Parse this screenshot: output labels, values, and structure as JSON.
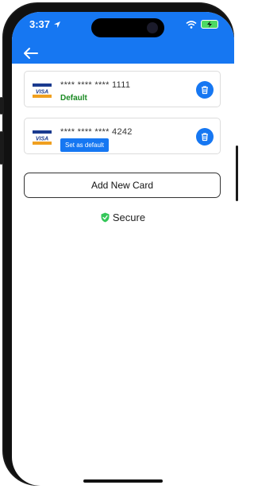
{
  "status_bar": {
    "time": "3:37"
  },
  "cards": [
    {
      "brand": "VISA",
      "number": "**** **** **** 1111",
      "status_label": "Default",
      "is_default": true
    },
    {
      "brand": "VISA",
      "number": "**** **** **** 4242",
      "status_label": "Set as default",
      "is_default": false
    }
  ],
  "add_card_label": "Add New Card",
  "secure_label": "Secure",
  "colors": {
    "accent": "#1677f2",
    "default_green": "#1a8a23",
    "secure_green": "#34c759"
  },
  "icons": {
    "back": "arrow-left-icon",
    "delete": "trash-icon",
    "secure": "shield-check-icon",
    "brand": "visa-icon"
  }
}
